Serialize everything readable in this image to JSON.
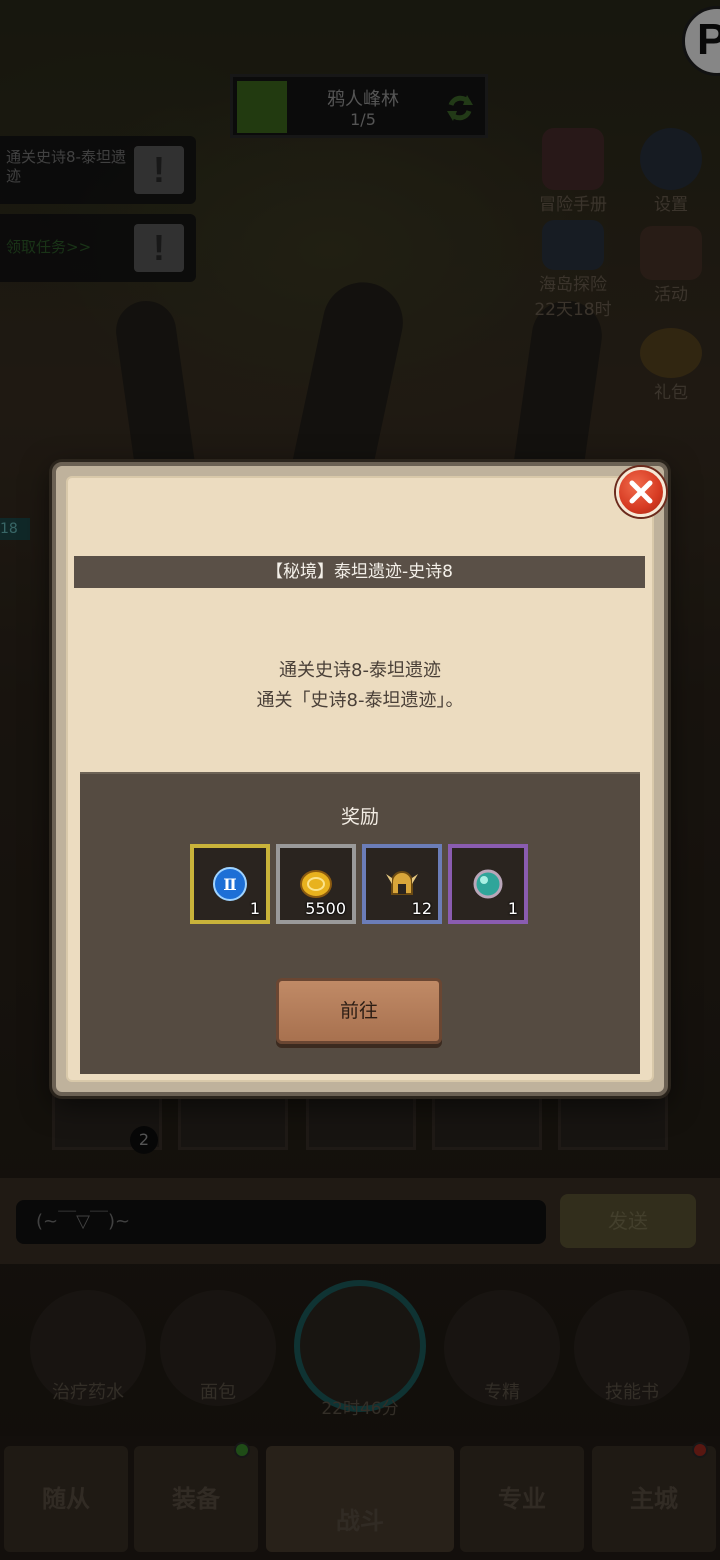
{
  "corner_badge": "P",
  "stage": {
    "name": "鸦人峰林",
    "progress": "1/5"
  },
  "quests": [
    {
      "text": "通关史诗8-泰坦遗迹"
    },
    {
      "text": "领取任务>>"
    }
  ],
  "side_icons": [
    {
      "label": "冒险手册"
    },
    {
      "label": "设置"
    },
    {
      "label": "海岛探险"
    },
    {
      "label": "活动"
    },
    {
      "label": "22天18时"
    },
    {
      "label": "礼包"
    }
  ],
  "hp_tag": "18",
  "card_badge": "2",
  "chat": {
    "input_text": "(~￣▽￣)~",
    "send_label": "发送"
  },
  "items": [
    {
      "label": "治疗药水"
    },
    {
      "label": "面包"
    },
    {
      "label": "专精"
    },
    {
      "label": "技能书"
    }
  ],
  "chest_timer": "22时46分",
  "nav": [
    {
      "label": "随从"
    },
    {
      "label": "装备"
    },
    {
      "label": "战斗"
    },
    {
      "label": "专业"
    },
    {
      "label": "主城"
    }
  ],
  "modal": {
    "title": "【秘境】泰坦遗迹-史诗8",
    "task_name": "通关史诗8-泰坦遗迹",
    "task_desc": "通关「史诗8-泰坦遗迹」。",
    "reward_title": "奖励",
    "rewards": [
      {
        "icon": "blue-rune-icon",
        "count": "1",
        "frame_color": "#c9b33a"
      },
      {
        "icon": "gold-coin-icon",
        "count": "5500",
        "frame_color": "#9a9a9a"
      },
      {
        "icon": "helmet-icon",
        "count": "12",
        "frame_color": "#6b7db8"
      },
      {
        "icon": "gem-orb-icon",
        "count": "1",
        "frame_color": "#8a5cb0"
      }
    ],
    "go_label": "前往"
  },
  "colors": {
    "close_button": "#d63a22",
    "title_bar": "#5a5047",
    "reward_panel": "#554b41",
    "go_button": "#b07a57"
  }
}
